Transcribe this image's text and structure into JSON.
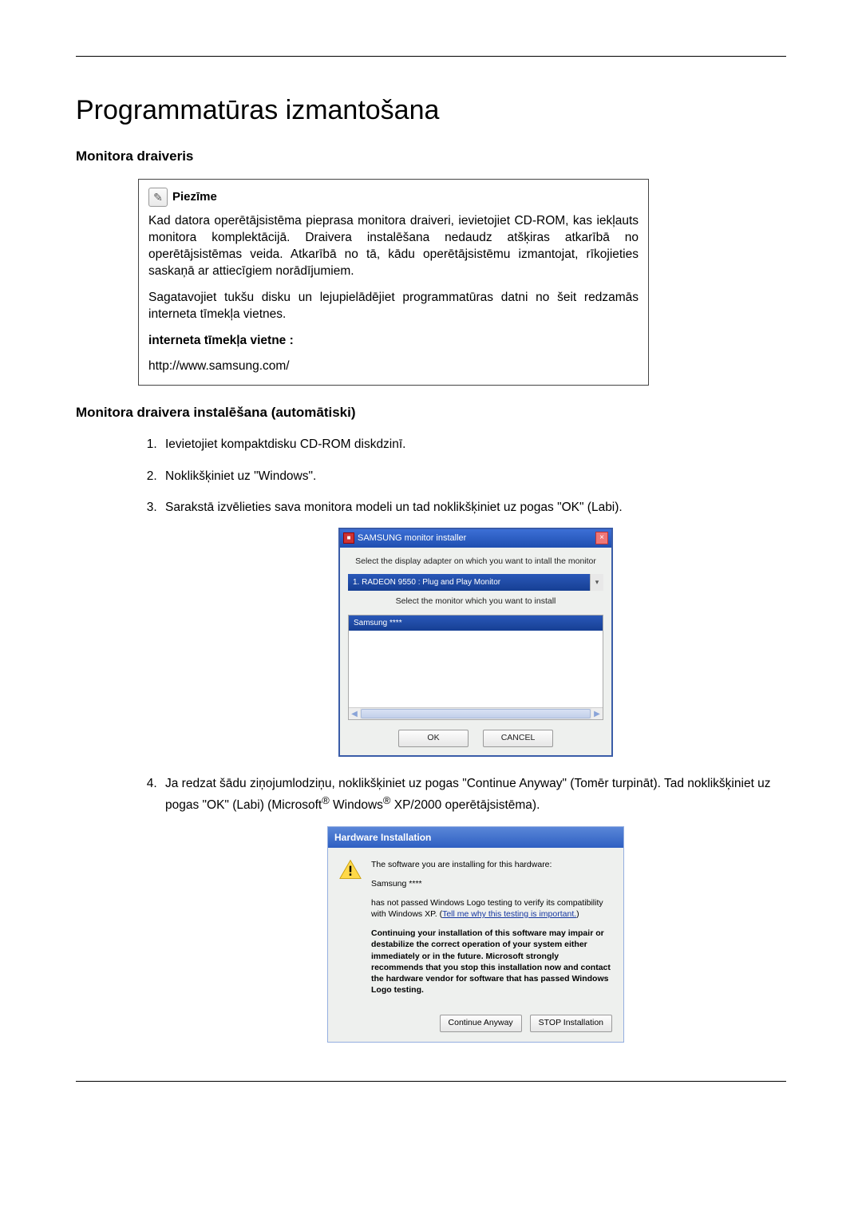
{
  "title": "Programmatūras izmantošana",
  "section1_heading": "Monitora draiveris",
  "note": {
    "label": "Piezīme",
    "p1": "Kad datora operētājsistēma pieprasa monitora draiveri, ievietojiet CD-ROM, kas iekļauts monitora komplektācijā. Draivera instalēšana nedaudz atšķiras atkarībā no operētājsistēmas veida. Atkarībā no tā, kādu operētājsistēmu izmantojat, rīkojieties saskaņā ar attiecīgiem norādījumiem.",
    "p2": "Sagatavojiet tukšu disku un lejupielādējiet programmatūras datni no šeit redzamās interneta tīmekļa vietnes.",
    "site_label": "interneta tīmekļa vietne :",
    "url": "http://www.samsung.com/"
  },
  "section2_heading": "Monitora draivera instalēšana (automātiski)",
  "steps": {
    "s1": "Ievietojiet kompaktdisku CD-ROM diskdzinī.",
    "s2": "Noklikšķiniet uz \"Windows\".",
    "s3": "Sarakstā izvēlieties sava monitora modeli un tad noklikšķiniet uz pogas \"OK\" (Labi).",
    "s4_a": "Ja redzat šādu ziņojumlodziņu, noklikšķiniet uz pogas \"Continue Anyway\" (Tomēr turpināt). Tad noklikšķiniet uz pogas \"OK\" (Labi) (Microsoft",
    "s4_b": " Windows",
    "s4_c": " XP/2000 operētājsistēma)."
  },
  "installer": {
    "title": "SAMSUNG monitor installer",
    "instruction1": "Select the display adapter on which you want to intall the monitor",
    "adapter": "1. RADEON 9550 : Plug and Play Monitor",
    "instruction2": "Select the monitor which you want to install",
    "selected": "Samsung ****",
    "ok_btn": "OK",
    "cancel_btn": "CANCEL"
  },
  "hw": {
    "title": "Hardware Installation",
    "p1": "The software you are installing for this hardware:",
    "device": "Samsung ****",
    "p3a": "has not passed Windows Logo testing to verify its compatibility with Windows XP. (",
    "link": "Tell me why this testing is important.",
    "p3b": ")",
    "p4": "Continuing your installation of this software may impair or destabilize the correct operation of your system either immediately or in the future. Microsoft strongly recommends that you stop this installation now and contact the hardware vendor for software that has passed Windows Logo testing.",
    "continue_btn": "Continue Anyway",
    "stop_btn": "STOP Installation"
  }
}
